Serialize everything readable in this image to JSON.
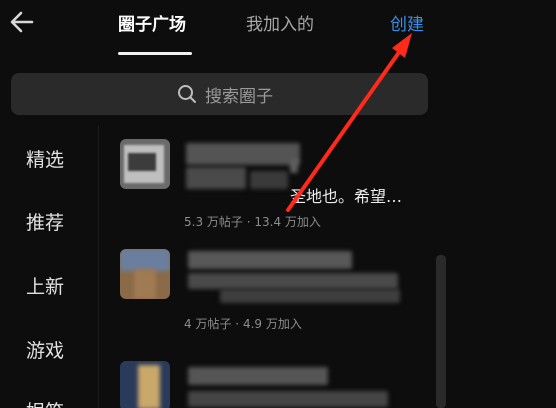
{
  "header": {
    "back_icon": "arrow-left-icon",
    "tabs": [
      {
        "label": "圈子广场",
        "active": true
      },
      {
        "label": "我加入的",
        "active": false
      }
    ],
    "create_label": "创建"
  },
  "search": {
    "icon": "search-icon",
    "placeholder": "搜索圈子"
  },
  "sidebar": {
    "items": [
      {
        "label": "精选"
      },
      {
        "label": "推荐"
      },
      {
        "label": "上新"
      },
      {
        "label": "游戏"
      },
      {
        "label": "娱笑"
      }
    ]
  },
  "circles": [
    {
      "name_visible": "圣地也。希望…",
      "posts": "5.3 万帖子",
      "sep": "·",
      "members": "13.4 万加入"
    },
    {
      "name_visible": "",
      "posts": "4 万帖子",
      "sep": "·",
      "members": "4.9 万加入"
    },
    {
      "name_visible": "",
      "posts": "",
      "sep": "",
      "members": ""
    }
  ],
  "colors": {
    "background": "#0d0d0d",
    "accent_blue": "#3a8fe8",
    "annotation_red": "#ff2a1a",
    "search_bg": "#2a2a2a"
  }
}
